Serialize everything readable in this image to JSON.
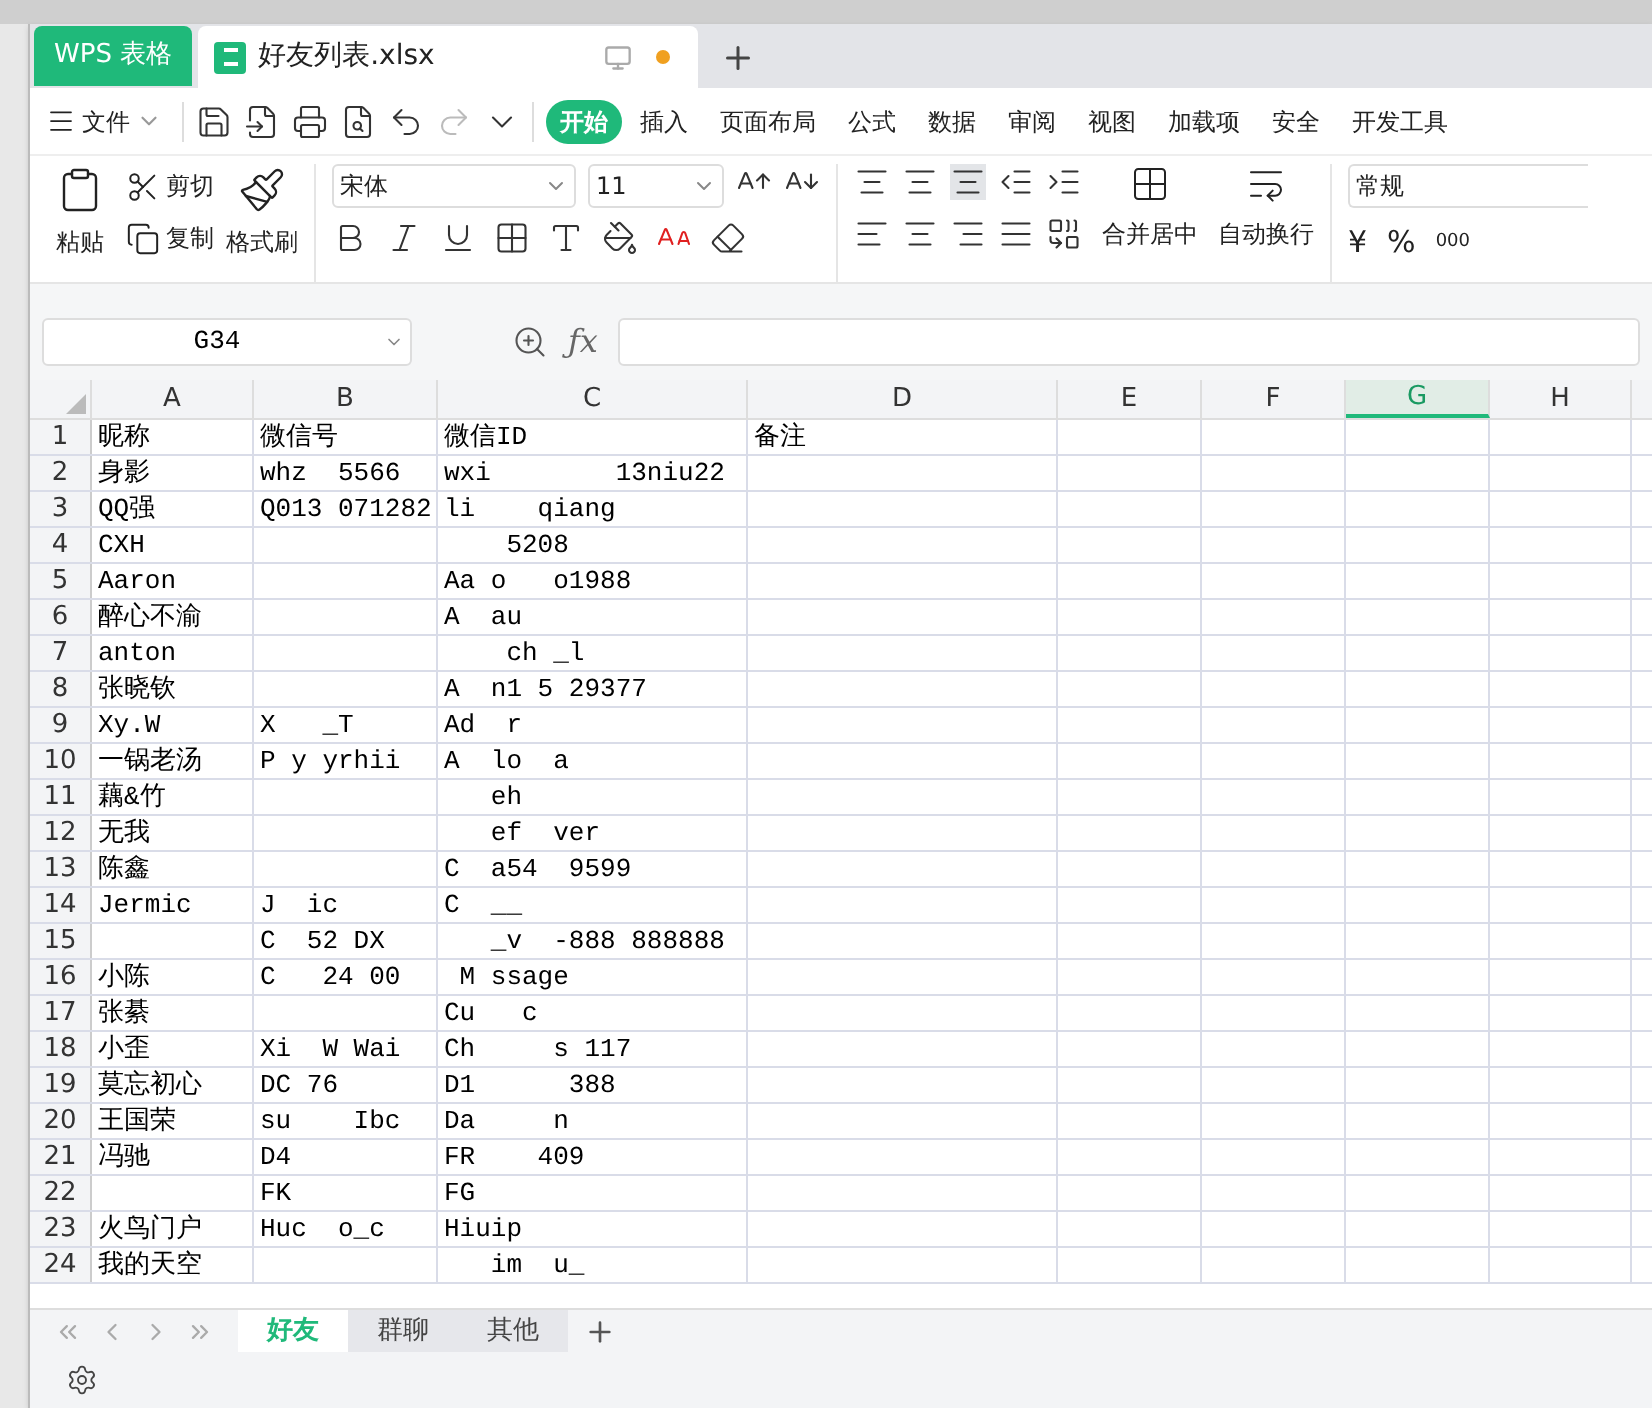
{
  "app_tab": {
    "label": "WPS 表格"
  },
  "doc_tabs": [
    {
      "label": "好友列表.xlsx",
      "selected": true,
      "unsaved": true
    }
  ],
  "menu": {
    "file": "文件",
    "items": [
      {
        "label": "开始",
        "selected": true
      },
      {
        "label": "插入",
        "selected": false
      },
      {
        "label": "页面布局",
        "selected": false
      },
      {
        "label": "公式",
        "selected": false
      },
      {
        "label": "数据",
        "selected": false
      },
      {
        "label": "审阅",
        "selected": false
      },
      {
        "label": "视图",
        "selected": false
      },
      {
        "label": "加载项",
        "selected": false
      },
      {
        "label": "安全",
        "selected": false
      },
      {
        "label": "开发工具",
        "selected": false
      }
    ]
  },
  "ribbon": {
    "paste": "粘贴",
    "cut": "剪切",
    "copy": "复制",
    "format_painter": "格式刷",
    "font": "宋体",
    "font_size": "11",
    "merge": "合并居中",
    "wrap": "自动换行",
    "number_format": "常规",
    "currency": "¥",
    "percent": "%",
    "thousands": "000"
  },
  "name_box": "G34",
  "function_label": "ƒx",
  "columns": [
    {
      "label": "A",
      "selected": false
    },
    {
      "label": "B",
      "selected": false
    },
    {
      "label": "C",
      "selected": false
    },
    {
      "label": "D",
      "selected": false
    },
    {
      "label": "E",
      "selected": false
    },
    {
      "label": "F",
      "selected": false
    },
    {
      "label": "G",
      "selected": true
    },
    {
      "label": "H",
      "selected": false
    }
  ],
  "rows": [
    {
      "n": "1",
      "cells": [
        "昵称",
        "微信号",
        "微信ID",
        "备注"
      ]
    },
    {
      "n": "2",
      "cells": [
        "身影",
        "whz  5566",
        "wxi        13niu22",
        ""
      ]
    },
    {
      "n": "3",
      "cells": [
        "QQ强",
        "Q013 071282",
        "li    qiang",
        ""
      ]
    },
    {
      "n": "4",
      "cells": [
        "CXH",
        "",
        "    5208",
        ""
      ]
    },
    {
      "n": "5",
      "cells": [
        "Aaron",
        "",
        "Aa o   o1988",
        ""
      ]
    },
    {
      "n": "6",
      "cells": [
        "醉心不渝",
        "",
        "A  au",
        ""
      ]
    },
    {
      "n": "7",
      "cells": [
        "anton",
        "",
        "    ch _l",
        ""
      ]
    },
    {
      "n": "8",
      "cells": [
        "张晓钦",
        "",
        "A  n1 5 29377",
        ""
      ]
    },
    {
      "n": "9",
      "cells": [
        "Xy.W",
        "X   _T",
        "Ad  r",
        ""
      ]
    },
    {
      "n": "10",
      "cells": [
        "一锅老汤",
        "P y yrhii",
        "A  lo  a",
        ""
      ]
    },
    {
      "n": "11",
      "cells": [
        "藕&竹",
        "",
        "   eh",
        ""
      ]
    },
    {
      "n": "12",
      "cells": [
        "无我",
        "",
        "   ef  ver",
        ""
      ]
    },
    {
      "n": "13",
      "cells": [
        "陈鑫",
        "",
        "C  a54  9599",
        ""
      ]
    },
    {
      "n": "14",
      "cells": [
        "Jermic",
        "J  ic",
        "C  __",
        ""
      ]
    },
    {
      "n": "15",
      "cells": [
        "",
        "C  52 DX",
        "   _v  -888 888888",
        ""
      ]
    },
    {
      "n": "16",
      "cells": [
        "小陈",
        "C   24 00",
        " M ssage",
        ""
      ]
    },
    {
      "n": "17",
      "cells": [
        "张綦",
        "",
        "Cu   c",
        ""
      ]
    },
    {
      "n": "18",
      "cells": [
        "小歪",
        "Xi  W Wai",
        "Ch     s 117",
        ""
      ]
    },
    {
      "n": "19",
      "cells": [
        "莫忘初心",
        "DC 76",
        "D1      388",
        ""
      ]
    },
    {
      "n": "20",
      "cells": [
        "王国荣",
        "su    Ibc",
        "Da     n",
        ""
      ]
    },
    {
      "n": "21",
      "cells": [
        "冯驰",
        "D4",
        "FR    409",
        ""
      ]
    },
    {
      "n": "22",
      "cells": [
        "",
        "FK",
        "FG",
        ""
      ]
    },
    {
      "n": "23",
      "cells": [
        "火鸟门户",
        "Huc  o_c",
        "Hiuip",
        ""
      ]
    },
    {
      "n": "24",
      "cells": [
        "我的天空",
        "",
        "   im  u_",
        ""
      ]
    }
  ],
  "sheets": [
    {
      "label": "好友",
      "selected": true
    },
    {
      "label": "群聊",
      "selected": false
    },
    {
      "label": "其他",
      "selected": false
    }
  ]
}
